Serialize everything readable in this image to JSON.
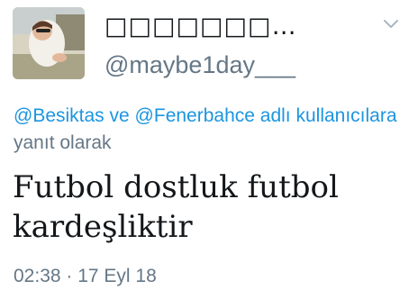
{
  "author": {
    "display_name": "□□□□□□□…",
    "handle": "@maybe1day___"
  },
  "reply_context": {
    "mention_1": "@Besiktas",
    "conjunction": " ve ",
    "mention_2": "@Fenerbahce",
    "accounts_suffix": " adlı kullanıcılara",
    "reply_label": " yanıt olarak"
  },
  "tweet": {
    "text": "Futbol dostluk futbol kardeşliktir",
    "time": "02:38",
    "separator": " · ",
    "date": "17 Eyl 18"
  },
  "icons": {
    "menu": "chevron-down-icon"
  },
  "colors": {
    "text": "#14171a",
    "secondary": "#657786",
    "link": "#1b95e0",
    "background": "#ffffff"
  }
}
